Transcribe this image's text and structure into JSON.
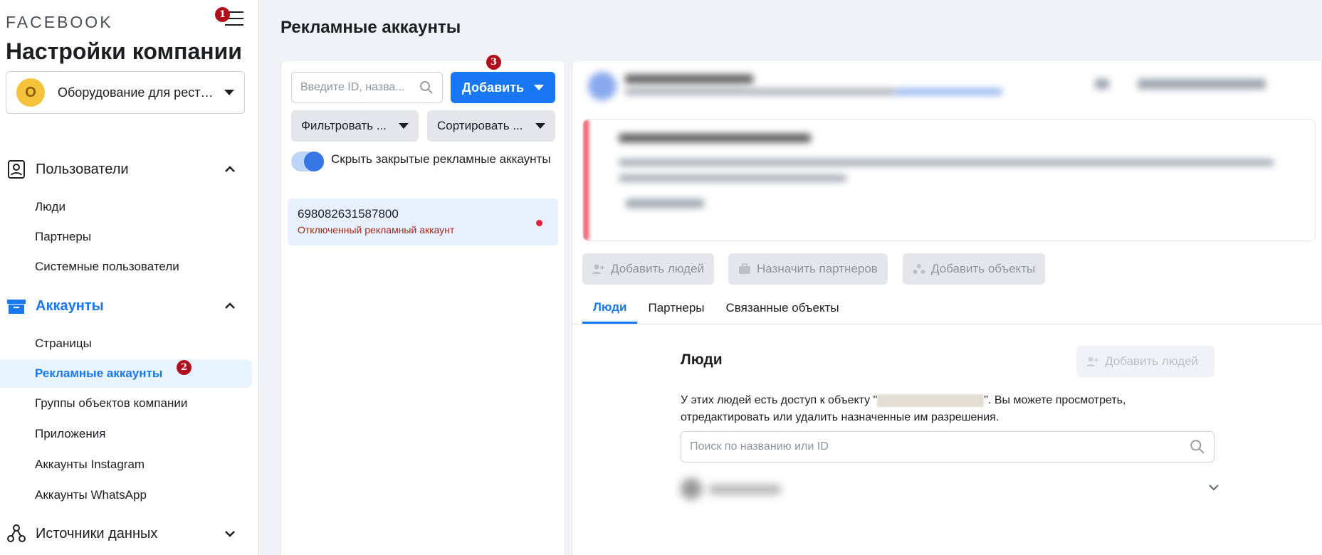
{
  "brand": {
    "logo_text": "FACEBOOK"
  },
  "sidebar": {
    "title": "Настройки компании",
    "company": {
      "initial": "О",
      "name": "Оборудование для рест…"
    },
    "sections": [
      {
        "label": "Пользователи",
        "icon": "users-card-icon",
        "expanded": true,
        "items": [
          "Люди",
          "Партнеры",
          "Системные пользователи"
        ]
      },
      {
        "label": "Аккаунты",
        "icon": "briefcase-icon",
        "expanded": true,
        "items": [
          "Страницы",
          "Рекламные аккаунты",
          "Группы объектов компании",
          "Приложения",
          "Аккаунты Instagram",
          "Аккаунты WhatsApp"
        ]
      },
      {
        "label": "Источники данных",
        "icon": "data-sources-icon",
        "expanded": false,
        "items": []
      }
    ],
    "active_item": "Рекламные аккаунты"
  },
  "badges": {
    "one": "1",
    "two": "2",
    "three": "3"
  },
  "main": {
    "page_title": "Рекламные аккаунты",
    "search_placeholder": "Введите ID, назва...",
    "add_label": "Добавить",
    "filter_label": "Фильтровать ...",
    "sort_label": "Сортировать ...",
    "toggle_label": "Скрыть закрытые рекламные аккаунты",
    "toggle_on": true,
    "accounts": [
      {
        "id": "698082631587800",
        "status": "Отключенный рекламный аккаунт"
      }
    ]
  },
  "detail": {
    "actions": {
      "add_people": "Добавить людей",
      "assign_partners": "Назначить партнеров",
      "add_assets": "Добавить объекты"
    },
    "tabs": [
      "Люди",
      "Партнеры",
      "Связанные объекты"
    ],
    "active_tab": "Люди",
    "people": {
      "title": "Люди",
      "add_button": "Добавить людей",
      "desc_before": "У этих людей есть доступ к объекту \"",
      "desc_after": "\". Вы можете просмотреть, отредактировать или удалить назначенные им разрешения.",
      "search_placeholder": "Поиск по названию или ID"
    }
  },
  "colors": {
    "accent": "#1877f2",
    "badge": "#b0101e",
    "error": "#a22a1a"
  }
}
